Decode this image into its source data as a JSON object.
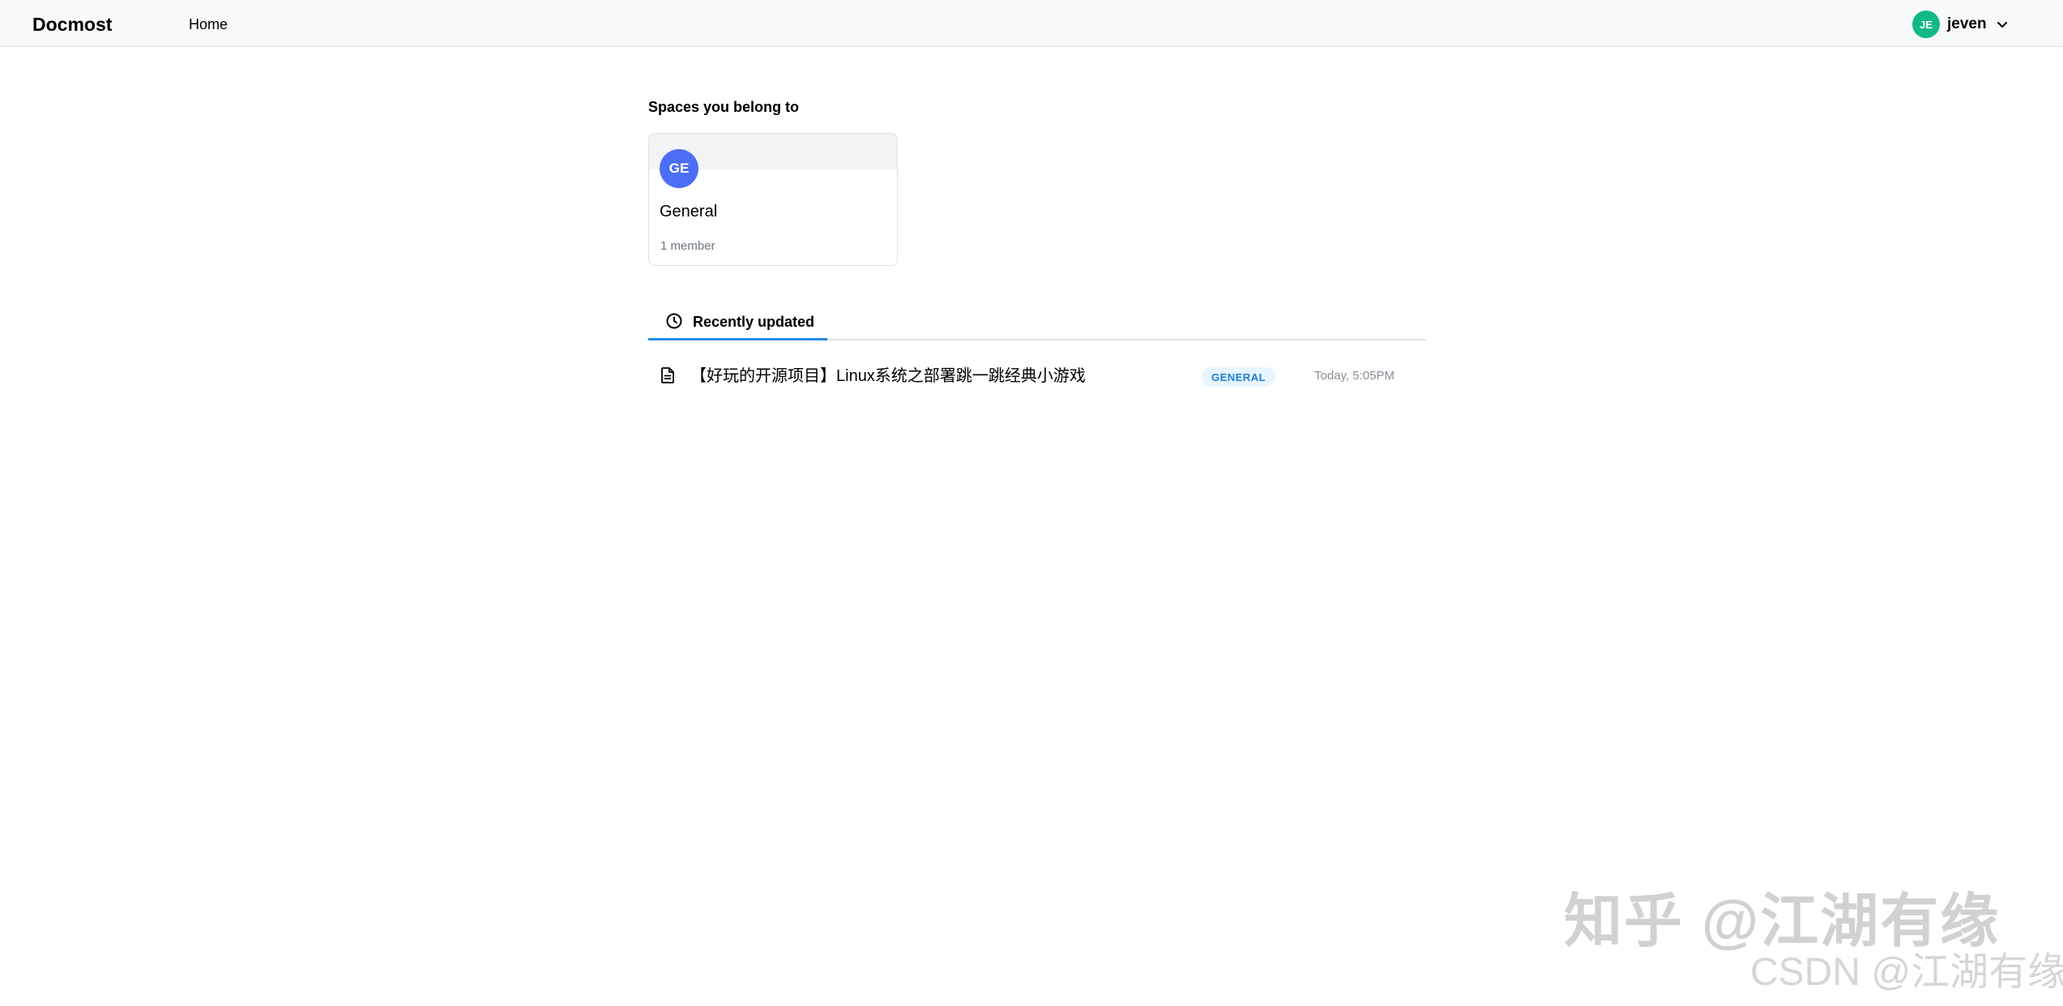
{
  "header": {
    "brand": "Docmost",
    "nav": {
      "home_label": "Home"
    },
    "user": {
      "initials": "JE",
      "name": "jeven",
      "avatar_color": "#12b886",
      "menu_icon": "chevron-down-icon"
    }
  },
  "spaces": {
    "title": "Spaces you belong to",
    "items": [
      {
        "initials": "GE",
        "name": "General",
        "members": "1 member",
        "avatar_color": "#4c6ef5"
      }
    ]
  },
  "tabs": {
    "active": {
      "label": "Recently updated",
      "icon": "clock-icon"
    }
  },
  "recent": {
    "items": [
      {
        "icon": "document-icon",
        "title": "【好玩的开源项目】Linux系统之部署跳一跳经典小游戏",
        "space": "GENERAL",
        "updated": "Today, 5:05PM"
      }
    ]
  },
  "watermarks": {
    "main": "知乎 @江湖有缘",
    "sub": "CSDN @江湖有缘"
  },
  "colors": {
    "accent": "#228be6",
    "badge_bg": "#e7f5ff",
    "badge_text": "#1c7ed6",
    "muted_text": "#868e96"
  }
}
